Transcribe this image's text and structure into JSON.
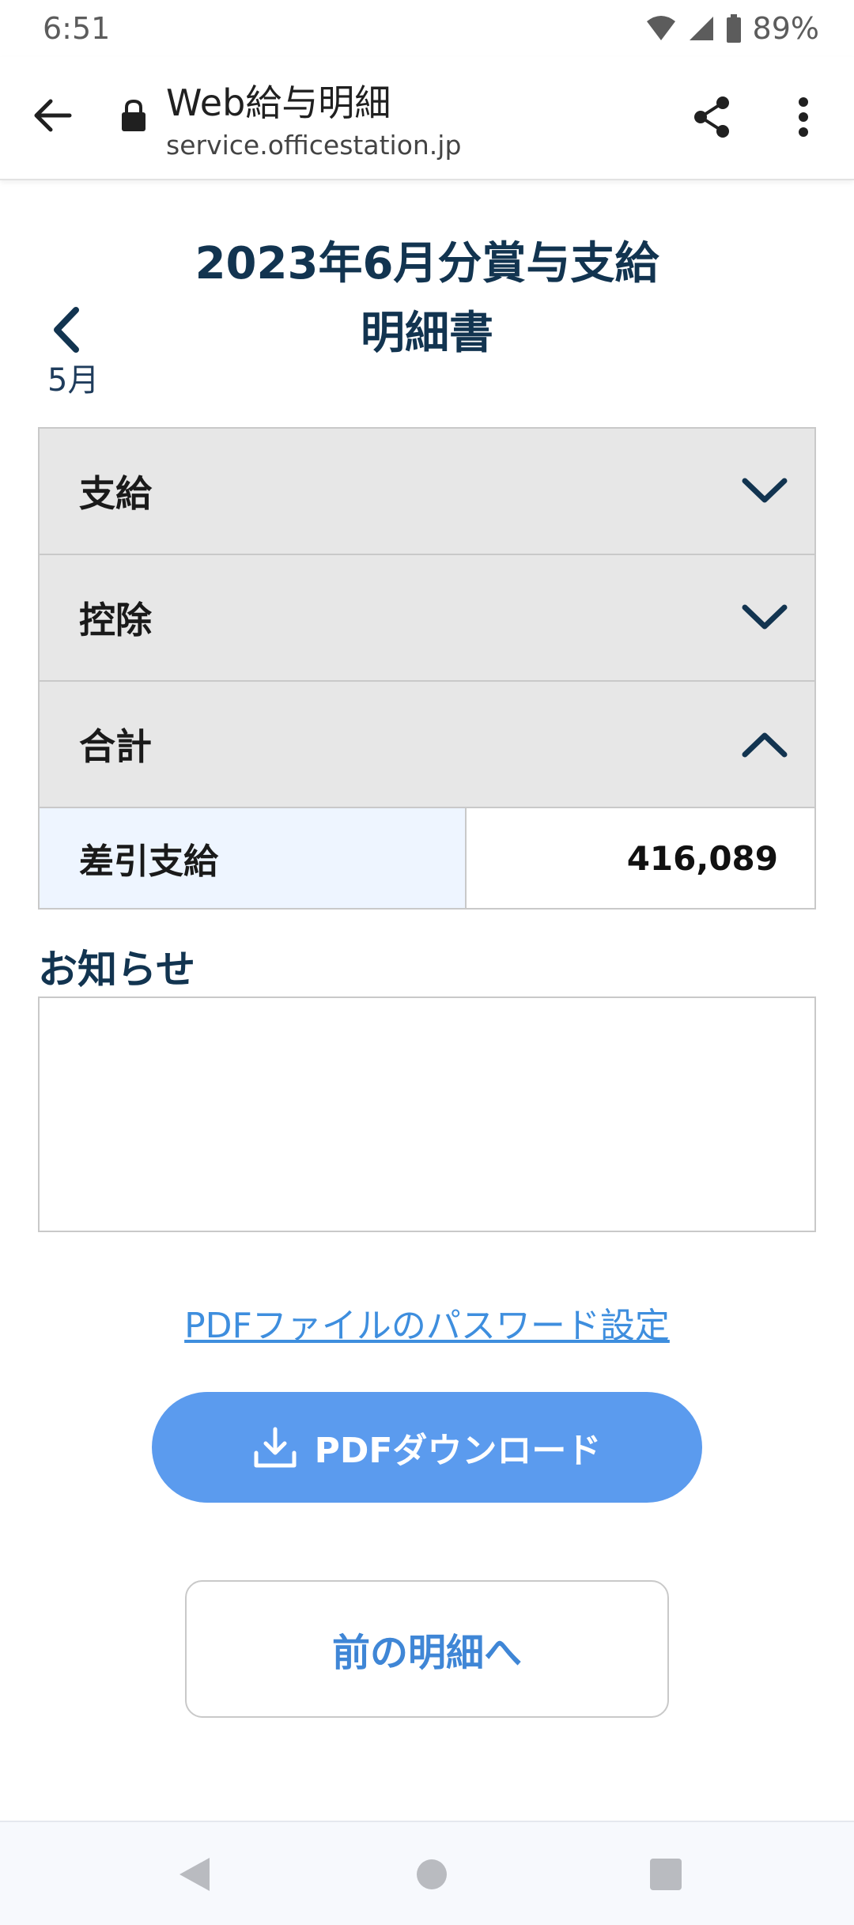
{
  "status_bar": {
    "time": "6:51",
    "battery": "89%"
  },
  "toolbar": {
    "title": "Web給与明細",
    "url": "service.officestation.jp"
  },
  "page": {
    "title_line1": "2023年6月分賞与支給",
    "title_line2": "明細書",
    "prev_month_label": "5月"
  },
  "accordion": {
    "items": [
      {
        "label": "支給",
        "expanded": false
      },
      {
        "label": "控除",
        "expanded": false
      },
      {
        "label": "合計",
        "expanded": true
      }
    ],
    "total_row": {
      "label": "差引支給",
      "value": "416,089"
    }
  },
  "notice": {
    "heading": "お知らせ",
    "content": ""
  },
  "actions": {
    "pdf_password_link": "PDFファイルのパスワード設定",
    "download_label": "PDFダウンロード",
    "prev_statement_label": "前の明細へ"
  },
  "colors": {
    "title": "#123450",
    "link": "#3e8ede",
    "primary_button": "#5b9bee",
    "accordion_header_bg": "#e7e7e7",
    "highlight_cell_bg": "#eef5ff"
  }
}
